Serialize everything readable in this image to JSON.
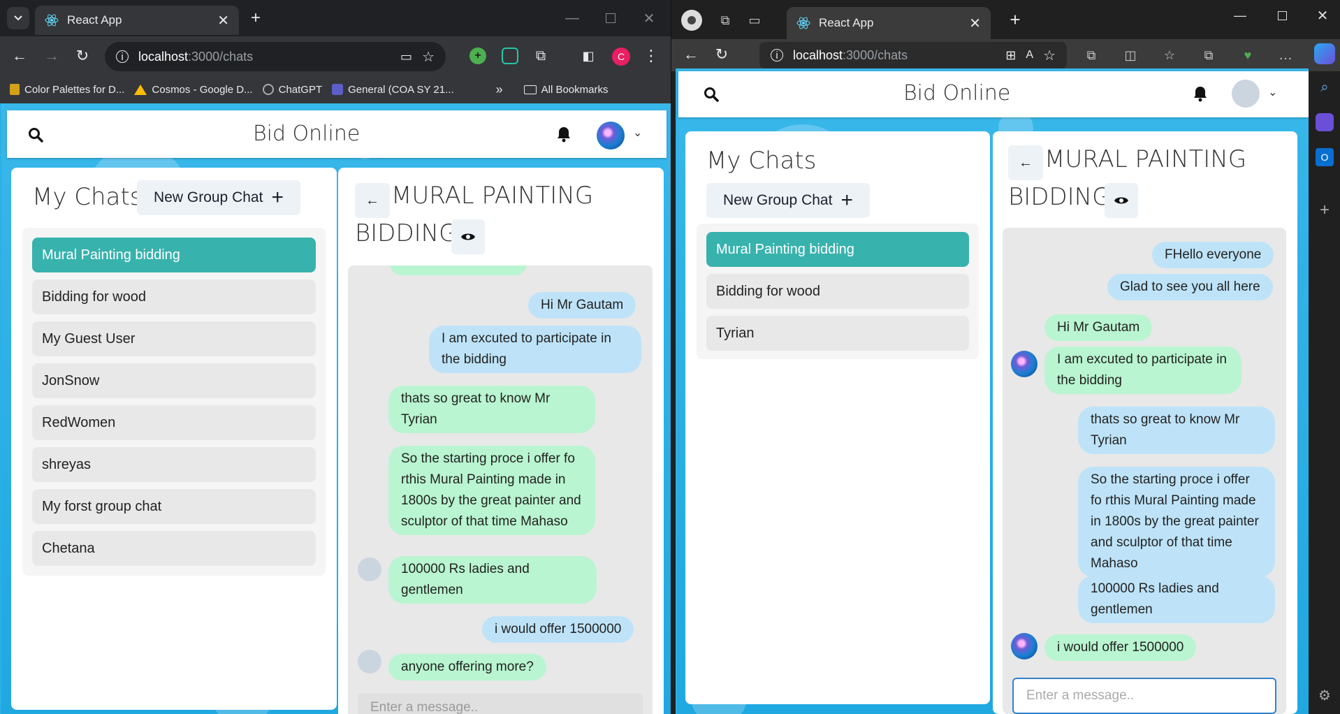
{
  "left_browser": {
    "tab_title": "React App",
    "url_host": "localhost",
    "url_path": ":3000/chats",
    "bookmarks": [
      "Color Palettes for D...",
      "Cosmos - Google D...",
      "ChatGPT",
      "General (COA SY 21..."
    ],
    "all_bookmarks": "All Bookmarks",
    "profile_initial": "C",
    "app": {
      "brand": "Bid Online",
      "sidebar_title": "My Chats",
      "new_group": "New Group Chat",
      "plus": "+",
      "chats": [
        "Mural Painting bidding",
        "Bidding for wood",
        "My Guest User",
        "JonSnow",
        "RedWomen",
        "shreyas",
        "My forst group chat",
        "Chetana"
      ],
      "chat_title_line1": "MURAL PAINTING",
      "chat_title_line2": "BIDDING",
      "messages": [
        "Hi Mr Gautam",
        "I am excuted to participate in the bidding",
        "thats so great to know Mr Tyrian",
        "So the starting proce i offer fo rthis Mural Painting made in 1800s by the great painter and sculptor of that time Mahaso",
        "100000 Rs ladies and gentlemen",
        "i would offer 1500000",
        "anyone offering more?"
      ],
      "input_placeholder": "Enter a message.."
    }
  },
  "right_browser": {
    "tab_title": "React App",
    "url_host": "localhost",
    "url_path": ":3000/chats",
    "app": {
      "brand": "Bid Online",
      "sidebar_title": "My Chats",
      "new_group": "New Group Chat",
      "plus": "+",
      "chats": [
        "Mural Painting bidding",
        "Bidding for wood",
        "Tyrian"
      ],
      "chat_title_line1": "MURAL PAINTING",
      "chat_title_line2": "BIDDING",
      "messages": [
        "FHello everyone",
        "Glad to see you all here",
        "Hi Mr Gautam",
        "I am excuted to participate in the bidding",
        "thats so great to know Mr Tyrian",
        "So the starting proce i offer fo rthis Mural Painting made in 1800s by the great painter and sculptor of that time Mahaso",
        "100000 Rs ladies and gentlemen",
        "i would offer 1500000"
      ],
      "input_placeholder": "Enter a message.."
    }
  },
  "colors": {
    "accent": "#38b2ac",
    "my_bubble": "#bee3f8",
    "other_bubble": "#b9f5d0",
    "app_bg": "#2bb0e5"
  }
}
